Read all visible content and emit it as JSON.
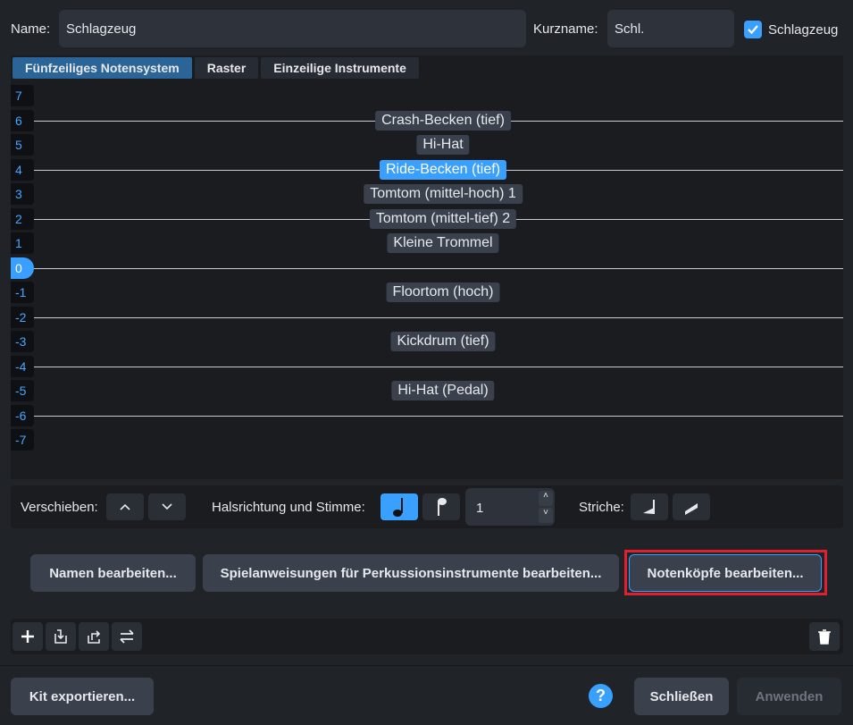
{
  "header": {
    "name_label": "Name:",
    "name_value": "Schlagzeug",
    "short_label": "Kurzname:",
    "short_value": "Schl.",
    "checkbox_label": "Schlagzeug",
    "checkbox_checked": true
  },
  "tabs": [
    {
      "label": "Fünfzeiliges Notensystem",
      "active": true
    },
    {
      "label": "Raster"
    },
    {
      "label": "Einzeilige Instrumente"
    }
  ],
  "staff": {
    "positions": [
      "7",
      "6",
      "5",
      "4",
      "3",
      "2",
      "1",
      "0",
      "-1",
      "-2",
      "-3",
      "-4",
      "-5",
      "-6",
      "-7"
    ],
    "selected_position": "0",
    "instruments": [
      {
        "position": 6,
        "name": "Crash-Becken (tief)"
      },
      {
        "position": 5,
        "name": "Hi-Hat"
      },
      {
        "position": 4,
        "name": "Ride-Becken (tief)",
        "selected": true
      },
      {
        "position": 3,
        "name": "Tomtom (mittel-hoch) 1"
      },
      {
        "position": 2,
        "name": "Tomtom (mittel-tief) 2"
      },
      {
        "position": 1,
        "name": "Kleine Trommel"
      },
      {
        "position": -1,
        "name": "Floortom (hoch)"
      },
      {
        "position": -3,
        "name": "Kickdrum (tief)"
      },
      {
        "position": -5,
        "name": "Hi-Hat (Pedal)"
      }
    ]
  },
  "controls": {
    "move_label": "Verschieben:",
    "stem_label": "Halsrichtung und Stimme:",
    "voice_value": "1",
    "strokes_label": "Striche:"
  },
  "buttons": {
    "edit_names": "Namen bearbeiten...",
    "edit_techniques": "Spielanweisungen für Perkussionsinstrumente bearbeiten...",
    "edit_noteheads": "Notenköpfe bearbeiten...",
    "export_kit": "Kit exportieren...",
    "close": "Schließen",
    "apply": "Anwenden",
    "help": "?"
  },
  "colors": {
    "accent": "#3aa0ff",
    "highlight": "#e0202e"
  }
}
